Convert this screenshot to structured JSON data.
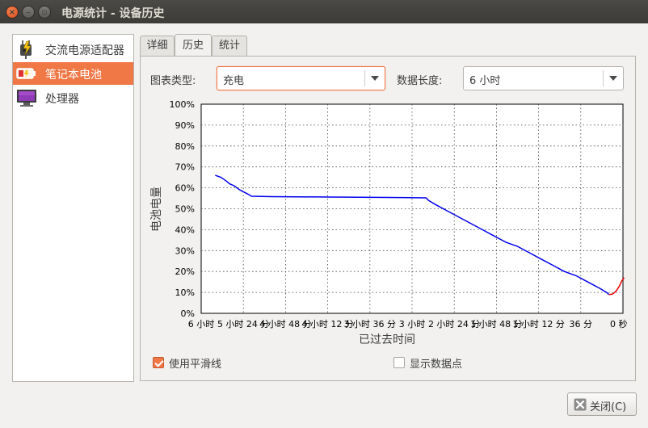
{
  "window": {
    "title": "电源统计 - 设备历史",
    "close_glyph": "×",
    "min_glyph": "–",
    "max_glyph": "▫"
  },
  "devices": [
    {
      "label": "交流电源适配器",
      "icon": "ac-adapter-icon",
      "selected": false
    },
    {
      "label": "笔记本电池",
      "icon": "battery-icon",
      "selected": true
    },
    {
      "label": "处理器",
      "icon": "processor-icon",
      "selected": false
    }
  ],
  "tabs": [
    {
      "label": "详细",
      "active": false
    },
    {
      "label": "历史",
      "active": true
    },
    {
      "label": "统计",
      "active": false
    }
  ],
  "controls": {
    "graph_type_label": "图表类型:",
    "graph_type_value": "充电",
    "data_length_label": "数据长度:",
    "data_length_value": "6 小时"
  },
  "options": {
    "smooth_label": "使用平滑线",
    "smooth_checked": true,
    "points_label": "显示数据点",
    "points_checked": false
  },
  "close_button": {
    "label": "关闭(C)"
  },
  "colors": {
    "accent": "#f07746",
    "discharge_line": "#0000ee",
    "charge_line": "#ee0000"
  },
  "chart_data": {
    "type": "line",
    "xlabel": "已过去时间",
    "ylabel": "电池电量",
    "ylim": [
      0,
      100
    ],
    "y_ticks": [
      "0%",
      "10%",
      "20%",
      "30%",
      "40%",
      "50%",
      "60%",
      "70%",
      "80%",
      "90%",
      "100%"
    ],
    "x_tick_labels": [
      "6 小时",
      "5 小时 24 分",
      "4 小时 48 分",
      "4 小时 12 分",
      "3 小时 36 分",
      "3 小时",
      "2 小时 24 分",
      "1 小时 48 分",
      "1 小时 12 分",
      "36 分",
      "0 秒"
    ],
    "x_minutes_ago_range": [
      360,
      0
    ],
    "grid": true,
    "series": [
      {
        "state": "discharging",
        "color": "#0000ee",
        "points": [
          [
            348,
            66
          ],
          [
            343,
            65
          ],
          [
            338,
            63
          ],
          [
            336,
            62
          ],
          [
            332,
            61
          ],
          [
            327,
            59
          ],
          [
            320,
            57
          ],
          [
            317,
            56
          ],
          [
            300,
            55.8
          ],
          [
            250,
            55.6
          ],
          [
            200,
            55.4
          ],
          [
            168,
            55.2
          ],
          [
            166,
            54
          ],
          [
            160,
            52
          ],
          [
            150,
            49
          ],
          [
            140,
            46
          ],
          [
            130,
            43
          ],
          [
            120,
            40
          ],
          [
            110,
            37
          ],
          [
            100,
            34
          ],
          [
            90,
            32
          ],
          [
            80,
            29
          ],
          [
            70,
            26
          ],
          [
            60,
            23
          ],
          [
            50,
            20
          ],
          [
            40,
            18
          ],
          [
            30,
            15
          ],
          [
            20,
            12
          ],
          [
            14,
            10
          ],
          [
            12,
            9
          ]
        ]
      },
      {
        "state": "charging",
        "color": "#ee0000",
        "points": [
          [
            12,
            9
          ],
          [
            9,
            9.2
          ],
          [
            6,
            10.5
          ],
          [
            3,
            13
          ],
          [
            1,
            15.5
          ],
          [
            -1,
            17
          ]
        ]
      }
    ]
  }
}
